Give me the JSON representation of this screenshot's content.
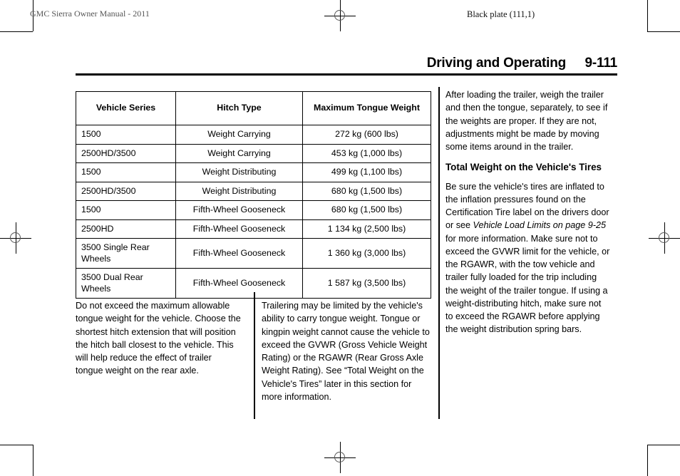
{
  "header": {
    "manual_line": "GMC Sierra Owner Manual - 2011",
    "plate_line": "Black plate (111,1)",
    "chapter_title": "Driving and Operating",
    "page_number": "9-111"
  },
  "table": {
    "columns": [
      "Vehicle Series",
      "Hitch Type",
      "Maximum Tongue Weight"
    ],
    "rows": [
      {
        "series": "1500",
        "hitch": "Weight Carrying",
        "weight": "272 kg (600 lbs)"
      },
      {
        "series": "2500HD/3500",
        "hitch": "Weight Carrying",
        "weight": "453 kg (1,000 lbs)"
      },
      {
        "series": "1500",
        "hitch": "Weight Distributing",
        "weight": "499 kg (1,100 lbs)"
      },
      {
        "series": "2500HD/3500",
        "hitch": "Weight Distributing",
        "weight": "680 kg (1,500 lbs)"
      },
      {
        "series": "1500",
        "hitch": "Fifth-Wheel Gooseneck",
        "weight": "680 kg (1,500 lbs)"
      },
      {
        "series": "2500HD",
        "hitch": "Fifth-Wheel Gooseneck",
        "weight": "1 134 kg (2,500 lbs)"
      },
      {
        "series": "3500 Single Rear Wheels",
        "hitch": "Fifth-Wheel Gooseneck",
        "weight": "1 360 kg (3,000 lbs)"
      },
      {
        "series": "3500 Dual Rear Wheels",
        "hitch": "Fifth-Wheel Gooseneck",
        "weight": "1 587 kg (3,500 lbs)"
      }
    ]
  },
  "columns": {
    "left": {
      "p1": "Do not exceed the maximum allowable tongue weight for the vehicle. Choose the shortest hitch extension that will position the hitch ball closest to the vehicle. This will help reduce the effect of trailer tongue weight on the rear axle."
    },
    "middle": {
      "p1": "Trailering may be limited by the vehicle's ability to carry tongue weight. Tongue or kingpin weight cannot cause the vehicle to exceed the GVWR (Gross Vehicle Weight Rating) or the RGAWR (Rear Gross Axle Weight Rating). See “Total Weight on the Vehicle's Tires” later in this section for more information."
    },
    "right": {
      "p1": "After loading the trailer, weigh the trailer and then the tongue, separately, to see if the weights are proper. If they are not, adjustments might be made by moving some items around in the trailer.",
      "subhead": "Total Weight on the Vehicle's Tires",
      "p2_before": "Be sure the vehicle's tires are inflated to the inflation pressures found on the Certification Tire label on the drivers door or see ",
      "p2_xref": "Vehicle Load Limits on page 9-25",
      "p2_after": " for more information. Make sure not to exceed the GVWR limit for the vehicle, or the RGAWR, with the tow vehicle and trailer fully loaded for the trip including the weight of the trailer tongue. If using a weight-distributing hitch, make sure not to exceed the RGAWR before applying the weight distribution spring bars."
    }
  }
}
